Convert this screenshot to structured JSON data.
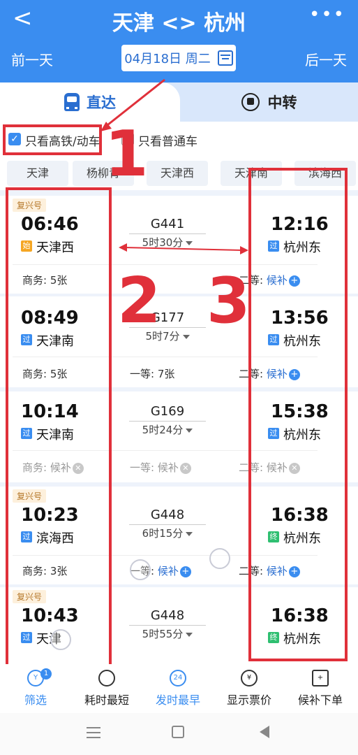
{
  "header": {
    "title": "天津 <> 杭州",
    "prev_day": "前一天",
    "next_day": "后一天",
    "date": "04月18日 周二",
    "more": "•••",
    "back": "<"
  },
  "tabs": {
    "direct": "直达",
    "transfer": "中转"
  },
  "filters": {
    "high_speed": "只看高铁/动车",
    "normal": "只看普通车",
    "check": "✓"
  },
  "stations": [
    "天津",
    "杨柳青",
    "天津西",
    "天津南",
    "滨海西"
  ],
  "trains": [
    {
      "badge": "复兴号",
      "dep": "06:46",
      "dep_tag": "始",
      "dep_station": "天津西",
      "no": "G441",
      "duration": "5时30分",
      "arr": "12:16",
      "arr_tag": "过",
      "arr_station": "杭州东",
      "seats": [
        {
          "label": "商务: 5张"
        },
        {
          "label": ""
        },
        {
          "label": "二等:",
          "status": "候补"
        }
      ]
    },
    {
      "badge": "",
      "dep": "08:49",
      "dep_tag": "过",
      "dep_station": "天津南",
      "no": "G177",
      "duration": "5时7分",
      "arr": "13:56",
      "arr_tag": "过",
      "arr_station": "杭州东",
      "seats": [
        {
          "label": "商务: 5张"
        },
        {
          "label": "一等: 7张"
        },
        {
          "label": "二等:",
          "status": "候补"
        }
      ]
    },
    {
      "badge": "",
      "dep": "10:14",
      "dep_tag": "过",
      "dep_station": "天津南",
      "no": "G169",
      "duration": "5时24分",
      "arr": "15:38",
      "arr_tag": "过",
      "arr_station": "杭州东",
      "seats": [
        {
          "label": "商务:",
          "status": "候补"
        },
        {
          "label": "一等:",
          "status": "候补"
        },
        {
          "label": "二等:",
          "status": "候补"
        }
      ]
    },
    {
      "badge": "复兴号",
      "dep": "10:23",
      "dep_tag": "过",
      "dep_station": "滨海西",
      "no": "G448",
      "duration": "6时15分",
      "arr": "16:38",
      "arr_tag": "终",
      "arr_station": "杭州东",
      "seats": [
        {
          "label": "商务: 3张"
        },
        {
          "label": "一等:",
          "status": "候补"
        },
        {
          "label": "二等:",
          "status": "候补"
        }
      ]
    },
    {
      "badge": "复兴号",
      "dep": "10:43",
      "dep_tag": "过",
      "dep_station": "天津",
      "no": "G448",
      "duration": "5时55分",
      "arr": "16:38",
      "arr_tag": "终",
      "arr_station": "杭州东",
      "seats": []
    }
  ],
  "bottom_bar": {
    "filter": "筛选",
    "filter_badge": "1",
    "shortest": "耗时最短",
    "earliest": "发时最早",
    "earliest_icon": "24",
    "show_price": "显示票价",
    "price_icon": "¥",
    "waitlist_order": "候补下单"
  },
  "annotations": [
    "1",
    "2",
    "3"
  ],
  "colors": {
    "brand": "#3a8df0",
    "annotation": "#e0303a"
  },
  "icons": {
    "waitlist_add": "plus-circle-icon",
    "unavailable": "x-circle-icon"
  }
}
